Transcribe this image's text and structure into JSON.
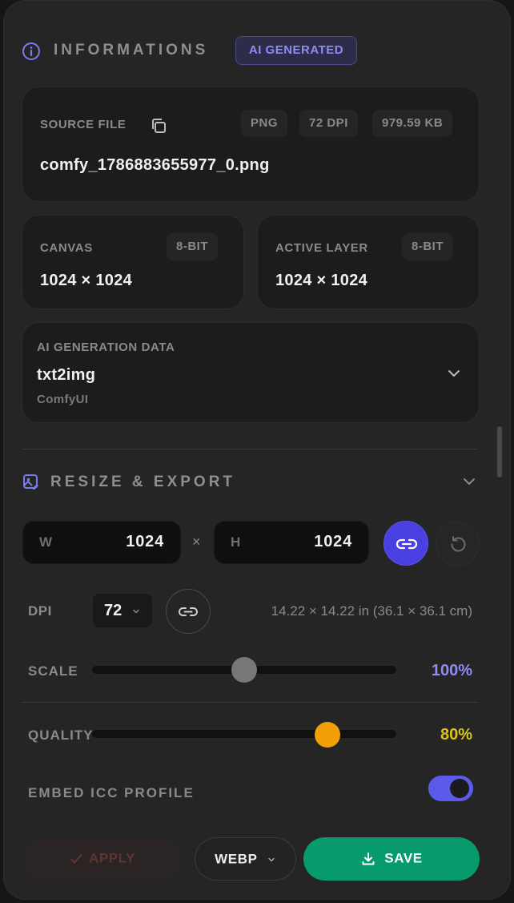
{
  "info": {
    "title": "INFORMATIONS",
    "badge": "AI GENERATED",
    "source": {
      "label": "SOURCE FILE",
      "filename": "comfy_1786883655977_0.png",
      "chips": [
        "PNG",
        "72 DPI",
        "979.59 KB"
      ]
    },
    "canvas": {
      "label": "CANVAS",
      "bit": "8-BIT",
      "size": "1024 × 1024"
    },
    "active_layer": {
      "label": "ACTIVE LAYER",
      "bit": "8-BIT",
      "size": "1024 × 1024"
    },
    "ai": {
      "label": "AI GENERATION DATA",
      "mode": "txt2img",
      "tool": "ComfyUI"
    }
  },
  "resize": {
    "title": "RESIZE & EXPORT",
    "width_prefix": "W",
    "width": "1024",
    "times": "×",
    "height_prefix": "H",
    "height": "1024",
    "dpi_label": "DPI",
    "dpi_value": "72",
    "print_size": "14.22 × 14.22 in (36.1 × 36.1 cm)",
    "scale_label": "SCALE",
    "scale_value": "100%",
    "scale_fraction": 0.5,
    "quality_label": "QUALITY",
    "quality_value": "80%",
    "quality_fraction": 0.8,
    "icc_label": "EMBED ICC PROFILE",
    "icc_on": true
  },
  "actions": {
    "apply": "APPLY",
    "format": "WEBP",
    "save": "SAVE"
  },
  "colors": {
    "accent": "#4a3fe0",
    "save": "#079a6c",
    "scale_text": "#8c8cf2",
    "quality": "#f2a007",
    "quality_text": "#d9c31a",
    "toggle": "#5b5bea"
  }
}
